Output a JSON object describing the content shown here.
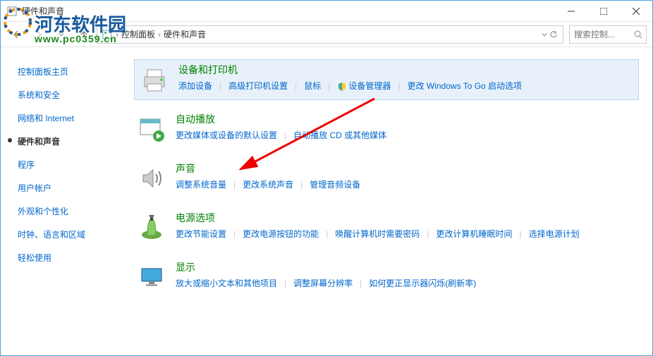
{
  "window": {
    "title": "硬件和声音"
  },
  "controls": {
    "min": "—",
    "max": "☐",
    "close": "✕"
  },
  "breadcrumb": {
    "seg1": "控制面板",
    "seg2": "硬件和声音"
  },
  "search": {
    "placeholder": "搜索控制..."
  },
  "sidebar": {
    "items": [
      {
        "label": "控制面板主页"
      },
      {
        "label": "系统和安全"
      },
      {
        "label": "网络和 Internet"
      },
      {
        "label": "硬件和声音"
      },
      {
        "label": "程序"
      },
      {
        "label": "用户帐户"
      },
      {
        "label": "外观和个性化"
      },
      {
        "label": "时钟、语言和区域"
      },
      {
        "label": "轻松使用"
      }
    ]
  },
  "categories": [
    {
      "title": "设备和打印机",
      "links": [
        "添加设备",
        "高级打印机设置",
        "鼠标",
        "设备管理器",
        "更改 Windows To Go 启动选项"
      ],
      "shield_at": 3
    },
    {
      "title": "自动播放",
      "links": [
        "更改媒体或设备的默认设置",
        "自动播放 CD 或其他媒体"
      ]
    },
    {
      "title": "声音",
      "links": [
        "调整系统音量",
        "更改系统声音",
        "管理音频设备"
      ]
    },
    {
      "title": "电源选项",
      "links": [
        "更改节能设置",
        "更改电源按钮的功能",
        "唤醒计算机时需要密码",
        "更改计算机睡眠时间",
        "选择电源计划"
      ]
    },
    {
      "title": "显示",
      "links": [
        "放大或缩小文本和其他项目",
        "调整屏幕分辨率",
        "如何更正显示器闪烁(刷新率)"
      ]
    }
  ],
  "watermark": {
    "text": "河东软件园",
    "url": "www.pc0359.cn"
  }
}
